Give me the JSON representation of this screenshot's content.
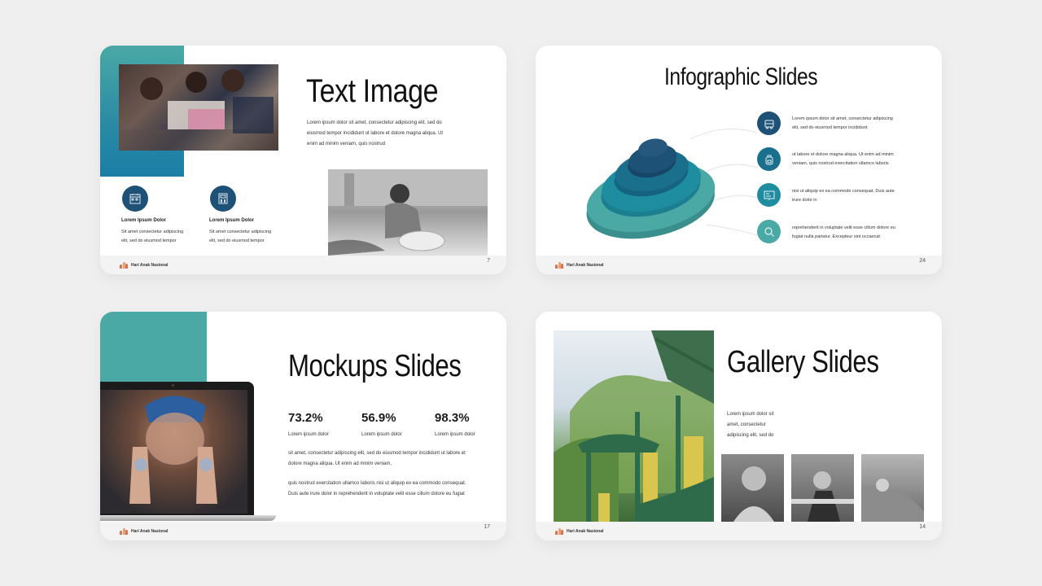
{
  "brand": {
    "name": "Hari Anak Nasional"
  },
  "colors": {
    "teal": "#4aa9a5",
    "navy": "#1d5176",
    "bg": "#efefef"
  },
  "slide_text_image": {
    "title": "Text Image",
    "paragraph_lines": [
      "Lorem ipsum dolor sit amet, consectetur adipiscing elit, sed do",
      "eiusmod tempor incididunt ut labore et dolore magna aliqua. Ut",
      "enim ad minim veniam, quis nostrud"
    ],
    "features": [
      {
        "icon": "calendar-icon",
        "title": "Lorem Ipsum Dolor",
        "lines": [
          "Sit amet consectetur adipiscing",
          "elit, sed do eiusmod tempor"
        ]
      },
      {
        "icon": "calculator-icon",
        "title": "Lorem Ipsum Dolor",
        "lines": [
          "Sit amet consectetur adipiscing",
          "elit, sed do eiusmod tempor"
        ]
      }
    ],
    "page": "7"
  },
  "slide_infographic": {
    "title": "Infographic Slides",
    "items": [
      {
        "icon": "bus-icon",
        "lines": [
          "Lorem ipsum dolor sit amet, consectetur adipiscing",
          "elit, sed do eiusmod tempor incididunt"
        ],
        "color": "#1d5176"
      },
      {
        "icon": "backpack-icon",
        "lines": [
          "ut labore et dolore magna aliqua. Ut enim ad minim",
          "veniam, quis nostrud exercitation ullamco laboris"
        ],
        "color": "#1a6f8c"
      },
      {
        "icon": "board-icon",
        "lines": [
          "nisi ut aliquip ex ea commodo consequat. Duis aute",
          "irure dolor in"
        ],
        "color": "#1e8da0"
      },
      {
        "icon": "search-icon",
        "lines": [
          "reprehenderit in voluptate velit esse cillum dolore eu",
          "fugiat nulla pariatur. Excepteur sint occaecat"
        ],
        "color": "#4aa9a5"
      }
    ],
    "page": "24"
  },
  "slide_mockups": {
    "title": "Mockups Slides",
    "stats": [
      {
        "value": "73.2%",
        "label": "Lorem ipsum dolor"
      },
      {
        "value": "56.9%",
        "label": "Lorem ipsum dolor"
      },
      {
        "value": "98.3%",
        "label": "Lorem ipsum dolor"
      }
    ],
    "paragraph1_lines": [
      "sit amet, consectetur adipiscing elit, sed do eiusmod tempor incididunt ut labore et",
      "dolore magna aliqua. Ut enim ad minim veniam,"
    ],
    "paragraph2_lines": [
      "quis nostrud exercitation ullamco laboris nisi ut aliquip ex ea commodo consequat.",
      "Duis aute irure dolor in reprehenderit in voluptate velit esse cillum dolore eu fugiat"
    ],
    "page": "17"
  },
  "slide_gallery": {
    "title": "Gallery Slides",
    "paragraph_lines": [
      "Lorem ipsum dolor sit",
      "amet, consectetur",
      "adipiscing elit, sed do"
    ],
    "page": "14"
  }
}
